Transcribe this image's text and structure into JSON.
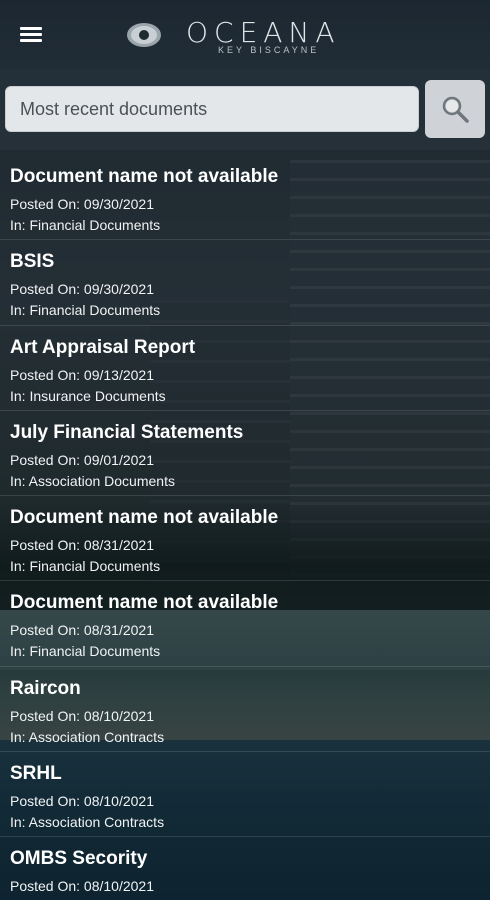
{
  "header": {
    "logo_name": "OCEANA",
    "logo_sub": "KEY BISCAYNE",
    "menu_icon": "hamburger-menu-icon",
    "logo_icon": "oceana-logo-mark"
  },
  "search": {
    "placeholder": "Most recent documents",
    "icon": "search-icon"
  },
  "documents": [
    {
      "title": "Document name not available",
      "posted": "Posted On: 09/30/2021",
      "category": "In: Financial Documents"
    },
    {
      "title": "BSIS",
      "posted": "Posted On: 09/30/2021",
      "category": "In: Financial Documents"
    },
    {
      "title": "Art Appraisal Report",
      "posted": "Posted On: 09/13/2021",
      "category": "In: Insurance Documents"
    },
    {
      "title": "July Financial Statements",
      "posted": "Posted On: 09/01/2021",
      "category": "In: Association Documents"
    },
    {
      "title": "Document name not available",
      "posted": "Posted On: 08/31/2021",
      "category": "In: Financial Documents"
    },
    {
      "title": "Document name not available",
      "posted": "Posted On: 08/31/2021",
      "category": "In: Financial Documents"
    },
    {
      "title": "Raircon",
      "posted": "Posted On: 08/10/2021",
      "category": "In: Association Contracts"
    },
    {
      "title": "SRHL",
      "posted": "Posted On: 08/10/2021",
      "category": "In: Association Contracts"
    },
    {
      "title": "OMBS Secority",
      "posted": "Posted On: 08/10/2021",
      "category": ""
    }
  ]
}
